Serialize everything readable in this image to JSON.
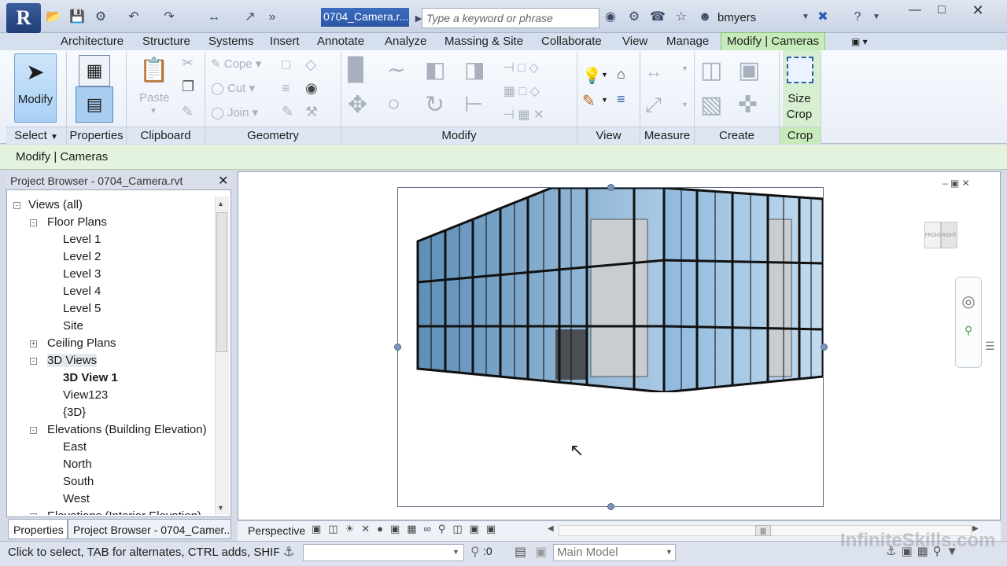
{
  "app": {
    "logo_letter": "R",
    "document_title": "0704_Camera.r...",
    "search_placeholder": "Type a keyword or phrase",
    "user": "bmyers"
  },
  "tabs": [
    "Architecture",
    "Structure",
    "Systems",
    "Insert",
    "Annotate",
    "Analyze",
    "Massing & Site",
    "Collaborate",
    "View",
    "Manage"
  ],
  "active_tab": "Modify | Cameras",
  "ribbon": {
    "modify": "Modify",
    "clipboard": {
      "paste": "Paste"
    },
    "geometry": {
      "cope": "Cope",
      "cut": "Cut",
      "join": "Join"
    },
    "crop": {
      "size_crop_line1": "Size",
      "size_crop_line2": "Crop"
    },
    "panels": [
      "Select",
      "Properties",
      "Clipboard",
      "Geometry",
      "Modify",
      "View",
      "Measure",
      "Create",
      "Crop"
    ]
  },
  "context_bar": "Modify | Cameras",
  "project_browser": {
    "title": "Project Browser - 0704_Camera.rvt",
    "items": [
      {
        "label": "Views (all)",
        "level": 0,
        "toggle": "-"
      },
      {
        "label": "Floor Plans",
        "level": 1,
        "toggle": "-"
      },
      {
        "label": "Level 1",
        "level": 2
      },
      {
        "label": "Level 2",
        "level": 2
      },
      {
        "label": "Level 3",
        "level": 2
      },
      {
        "label": "Level 4",
        "level": 2
      },
      {
        "label": "Level 5",
        "level": 2
      },
      {
        "label": "Site",
        "level": 2
      },
      {
        "label": "Ceiling Plans",
        "level": 1,
        "toggle": "+"
      },
      {
        "label": "3D Views",
        "level": 1,
        "toggle": "-"
      },
      {
        "label": "3D View 1",
        "level": 2,
        "bold": true
      },
      {
        "label": "View123",
        "level": 2
      },
      {
        "label": "{3D}",
        "level": 2
      },
      {
        "label": "Elevations (Building Elevation)",
        "level": 1,
        "toggle": "-"
      },
      {
        "label": "East",
        "level": 2
      },
      {
        "label": "North",
        "level": 2
      },
      {
        "label": "South",
        "level": 2
      },
      {
        "label": "West",
        "level": 2
      },
      {
        "label": "Elevations (Interior Elevation)",
        "level": 1,
        "toggle": "+"
      }
    ]
  },
  "bottom_tabs": [
    "Properties",
    "Project Browser - 0704_Camer..."
  ],
  "view": {
    "viewcube_front": "FRONT",
    "viewcube_right": "RIGHT"
  },
  "view_control": {
    "mode": "Perspective"
  },
  "status": {
    "text": "Click to select, TAB for alternates, CTRL adds, SHIFT un",
    "selection_count": ":0",
    "model": "Main Model"
  },
  "watermark": "InfiniteSkills.com"
}
